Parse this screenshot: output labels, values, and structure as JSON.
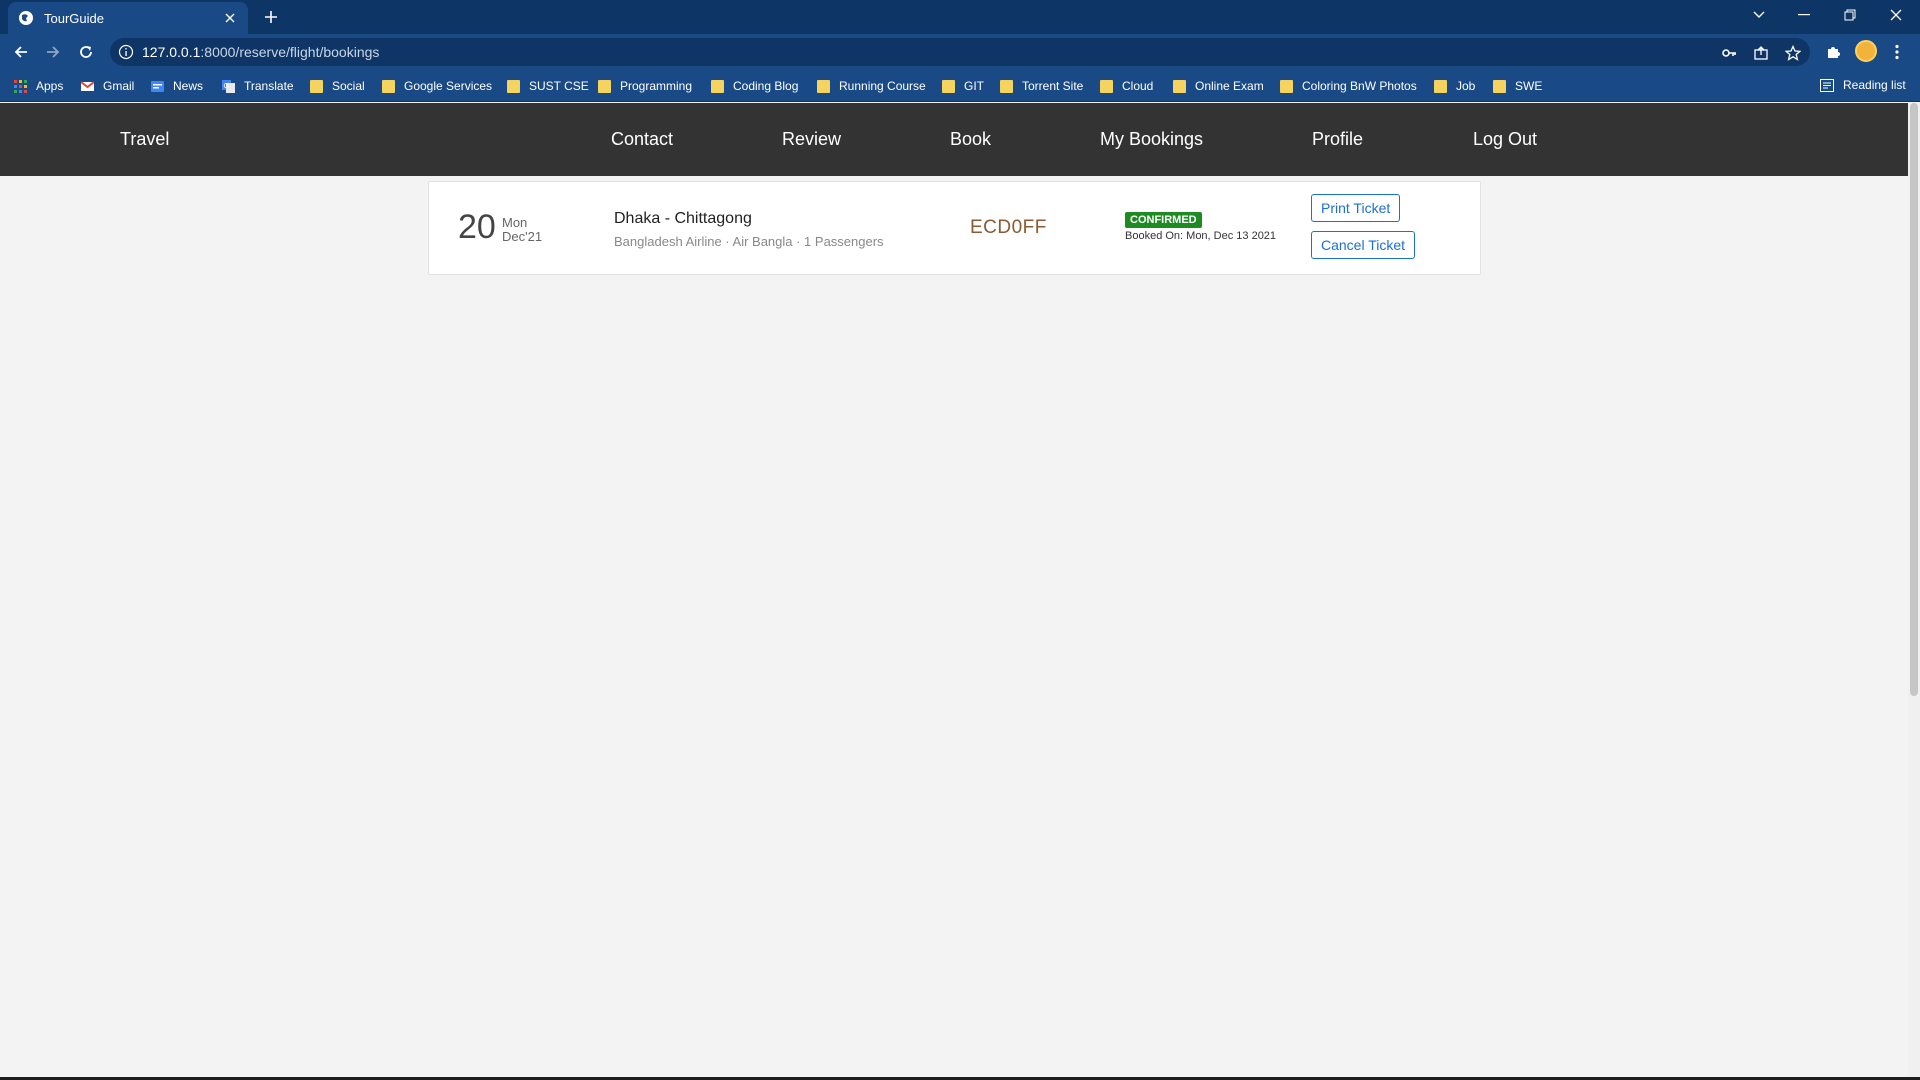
{
  "browser": {
    "tab_title": "TourGuide",
    "url_host": "127.0.0.1",
    "url_path": ":8000/reserve/flight/bookings",
    "reading_list": "Reading list",
    "bookmarks": [
      {
        "label": "Apps",
        "icon": "apps-grid-icon"
      },
      {
        "label": "Gmail",
        "icon": "gmail-icon"
      },
      {
        "label": "News",
        "icon": "google-news-icon"
      },
      {
        "label": "Translate",
        "icon": "google-translate-icon"
      },
      {
        "label": "Social",
        "icon": "folder-icon"
      },
      {
        "label": "Google Services",
        "icon": "folder-icon"
      },
      {
        "label": "SUST CSE",
        "icon": "folder-icon"
      },
      {
        "label": "Programming",
        "icon": "folder-icon"
      },
      {
        "label": "Coding Blog",
        "icon": "folder-icon"
      },
      {
        "label": "Running Course",
        "icon": "folder-icon"
      },
      {
        "label": "GIT",
        "icon": "folder-icon"
      },
      {
        "label": "Torrent Site",
        "icon": "folder-icon"
      },
      {
        "label": "Cloud",
        "icon": "folder-icon"
      },
      {
        "label": "Online Exam",
        "icon": "folder-icon"
      },
      {
        "label": "Coloring BnW Photos",
        "icon": "folder-icon"
      },
      {
        "label": "Job",
        "icon": "folder-icon"
      },
      {
        "label": "SWE",
        "icon": "folder-icon"
      }
    ],
    "colors": {
      "frame": "#0d3565",
      "toolbar": "#1a4a85"
    }
  },
  "nav": {
    "brand": "Travel",
    "links": [
      "Contact",
      "Review",
      "Book",
      "My Bookings",
      "Profile",
      "Log Out"
    ]
  },
  "bookings": [
    {
      "day": "20",
      "weekday": "Mon",
      "month": "Dec'21",
      "route": "Dhaka - Chittagong",
      "details": "Bangladesh Airline · Air Bangla · 1 Passengers",
      "ref": "ECD0FF",
      "status": "CONFIRMED",
      "booked_on": "Booked On: Mon, Dec 13 2021",
      "print_label": "Print Ticket",
      "cancel_label": "Cancel Ticket"
    }
  ],
  "colors": {
    "navbar": "#333333",
    "badge": "#1e8a22",
    "button": "#1a6fd8",
    "ref": "#8b5a32"
  }
}
